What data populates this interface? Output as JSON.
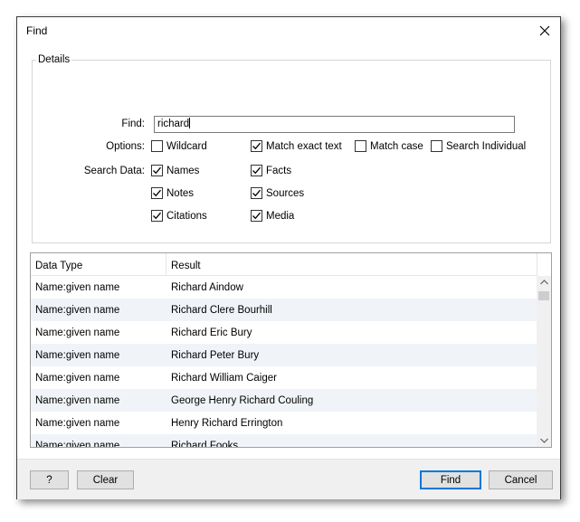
{
  "window": {
    "title": "Find"
  },
  "details": {
    "legend": "Details",
    "find_label": "Find:",
    "find_value": "richard",
    "options_label": "Options:",
    "search_data_label": "Search Data:",
    "options": [
      {
        "label": "Wildcard",
        "checked": false
      },
      {
        "label": "Match exact text",
        "checked": true
      },
      {
        "label": "Match case",
        "checked": false
      },
      {
        "label": "Search Individual",
        "checked": false
      }
    ],
    "search_data": [
      {
        "label": "Names",
        "checked": true
      },
      {
        "label": "Facts",
        "checked": true
      },
      {
        "label": "Notes",
        "checked": true
      },
      {
        "label": "Sources",
        "checked": true
      },
      {
        "label": "Citations",
        "checked": true
      },
      {
        "label": "Media",
        "checked": true
      }
    ]
  },
  "results": {
    "columns": [
      "Data Type",
      "Result"
    ],
    "rows": [
      [
        "Name:given name",
        "Richard Aindow"
      ],
      [
        "Name:given name",
        "Richard Clere Bourhill"
      ],
      [
        "Name:given name",
        "Richard Eric Bury"
      ],
      [
        "Name:given name",
        "Richard Peter Bury"
      ],
      [
        "Name:given name",
        "Richard William Caiger"
      ],
      [
        "Name:given name",
        "George Henry Richard Couling"
      ],
      [
        "Name:given name",
        "Henry Richard Errington"
      ],
      [
        "Name:given name",
        "Richard Fooks"
      ]
    ]
  },
  "footer": {
    "help_label": "?",
    "clear_label": "Clear",
    "find_label": "Find",
    "cancel_label": "Cancel"
  }
}
